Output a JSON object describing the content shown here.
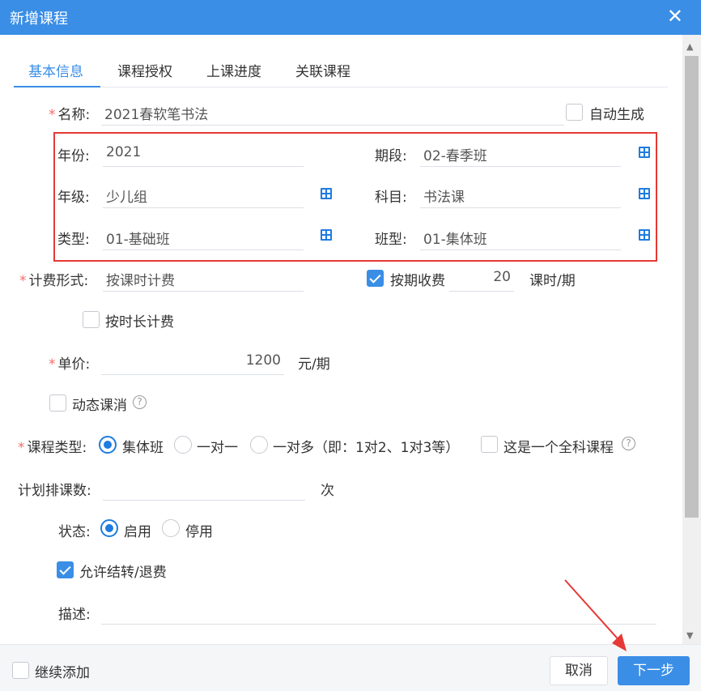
{
  "dialog": {
    "title": "新增课程",
    "close_glyph": "✕"
  },
  "tabs": [
    {
      "label": "基本信息",
      "active": true
    },
    {
      "label": "课程授权",
      "active": false
    },
    {
      "label": "上课进度",
      "active": false
    },
    {
      "label": "关联课程",
      "active": false
    }
  ],
  "form": {
    "required_mark": "*",
    "name": {
      "label": "名称:",
      "value": "2021春软笔书法"
    },
    "auto_generate": {
      "label": "自动生成",
      "checked": false
    },
    "year": {
      "label": "年份:",
      "value": "2021"
    },
    "period": {
      "label": "期段:",
      "value": "02-春季班"
    },
    "grade": {
      "label": "年级:",
      "value": "少儿组"
    },
    "subject": {
      "label": "科目:",
      "value": "书法课"
    },
    "type": {
      "label": "类型:",
      "value": "01-基础班"
    },
    "class_type": {
      "label": "班型:",
      "value": "01-集体班"
    },
    "billing": {
      "label": "计费形式:",
      "value": "按课时计费"
    },
    "per_term": {
      "label": "按期收费",
      "checked": true,
      "value": "20",
      "unit": "课时/期"
    },
    "by_duration": {
      "label": "按时长计费",
      "checked": false
    },
    "unit_price": {
      "label": "单价:",
      "value": "1200",
      "unit": "元/期"
    },
    "dynamic_deduct": {
      "label": "动态课消",
      "checked": false,
      "help": "?"
    },
    "course_kind": {
      "label": "课程类型:",
      "options": [
        "集体班",
        "一对一",
        "一对多（即：1对2、1对3等）"
      ],
      "selected": 0,
      "all_subject": {
        "label": "这是一个全科课程",
        "checked": false,
        "help": "?"
      }
    },
    "planned_sessions": {
      "label": "计划排课数:",
      "value": "",
      "unit": "次"
    },
    "status": {
      "label": "状态:",
      "options": [
        "启用",
        "停用"
      ],
      "selected": 0
    },
    "allow_transfer": {
      "label": "允许结转/退费",
      "checked": true
    },
    "description": {
      "label": "描述:",
      "value": ""
    }
  },
  "footer": {
    "continue_add": {
      "label": "继续添加",
      "checked": false
    },
    "cancel_label": "取消",
    "next_label": "下一步"
  },
  "colors": {
    "primary": "#3a8ee6",
    "highlight_box": "#e53935",
    "required": "#f56c6c",
    "annotation_arrow": "#e53935"
  }
}
